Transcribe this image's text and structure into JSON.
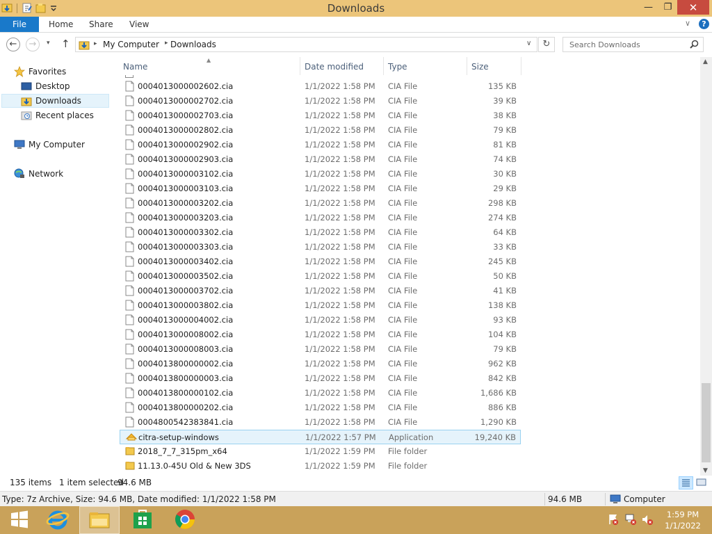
{
  "window": {
    "title": "Downloads",
    "minimize": "—",
    "maximize": "❐",
    "close": "✕"
  },
  "ribbon": {
    "file": "File",
    "home": "Home",
    "share": "Share",
    "view": "View",
    "expand": "∨",
    "help": "?"
  },
  "address": {
    "back": "←",
    "forward": "→",
    "recent": "▾",
    "up": "↑",
    "crumbs": [
      "My Computer",
      "Downloads"
    ],
    "sep": "▸",
    "dropdown": "∨",
    "refresh": "↻"
  },
  "search": {
    "placeholder": "Search Downloads"
  },
  "navpane": {
    "favorites": "Favorites",
    "desktop": "Desktop",
    "downloads": "Downloads",
    "recent_places": "Recent places",
    "my_computer": "My Computer",
    "network": "Network"
  },
  "columns": {
    "name": "Name",
    "date": "Date modified",
    "type": "Type",
    "size": "Size"
  },
  "files": [
    {
      "name": "0004013000002602.cia",
      "date": "1/1/2022 1:58 PM",
      "type": "CIA File",
      "size": "135 KB",
      "kind": "file"
    },
    {
      "name": "0004013000002702.cia",
      "date": "1/1/2022 1:58 PM",
      "type": "CIA File",
      "size": "39 KB",
      "kind": "file"
    },
    {
      "name": "0004013000002703.cia",
      "date": "1/1/2022 1:58 PM",
      "type": "CIA File",
      "size": "38 KB",
      "kind": "file"
    },
    {
      "name": "0004013000002802.cia",
      "date": "1/1/2022 1:58 PM",
      "type": "CIA File",
      "size": "79 KB",
      "kind": "file"
    },
    {
      "name": "0004013000002902.cia",
      "date": "1/1/2022 1:58 PM",
      "type": "CIA File",
      "size": "81 KB",
      "kind": "file"
    },
    {
      "name": "0004013000002903.cia",
      "date": "1/1/2022 1:58 PM",
      "type": "CIA File",
      "size": "74 KB",
      "kind": "file"
    },
    {
      "name": "0004013000003102.cia",
      "date": "1/1/2022 1:58 PM",
      "type": "CIA File",
      "size": "30 KB",
      "kind": "file"
    },
    {
      "name": "0004013000003103.cia",
      "date": "1/1/2022 1:58 PM",
      "type": "CIA File",
      "size": "29 KB",
      "kind": "file"
    },
    {
      "name": "0004013000003202.cia",
      "date": "1/1/2022 1:58 PM",
      "type": "CIA File",
      "size": "298 KB",
      "kind": "file"
    },
    {
      "name": "0004013000003203.cia",
      "date": "1/1/2022 1:58 PM",
      "type": "CIA File",
      "size": "274 KB",
      "kind": "file"
    },
    {
      "name": "0004013000003302.cia",
      "date": "1/1/2022 1:58 PM",
      "type": "CIA File",
      "size": "64 KB",
      "kind": "file"
    },
    {
      "name": "0004013000003303.cia",
      "date": "1/1/2022 1:58 PM",
      "type": "CIA File",
      "size": "33 KB",
      "kind": "file"
    },
    {
      "name": "0004013000003402.cia",
      "date": "1/1/2022 1:58 PM",
      "type": "CIA File",
      "size": "245 KB",
      "kind": "file"
    },
    {
      "name": "0004013000003502.cia",
      "date": "1/1/2022 1:58 PM",
      "type": "CIA File",
      "size": "50 KB",
      "kind": "file"
    },
    {
      "name": "0004013000003702.cia",
      "date": "1/1/2022 1:58 PM",
      "type": "CIA File",
      "size": "41 KB",
      "kind": "file"
    },
    {
      "name": "0004013000003802.cia",
      "date": "1/1/2022 1:58 PM",
      "type": "CIA File",
      "size": "138 KB",
      "kind": "file"
    },
    {
      "name": "0004013000004002.cia",
      "date": "1/1/2022 1:58 PM",
      "type": "CIA File",
      "size": "93 KB",
      "kind": "file"
    },
    {
      "name": "0004013000008002.cia",
      "date": "1/1/2022 1:58 PM",
      "type": "CIA File",
      "size": "104 KB",
      "kind": "file"
    },
    {
      "name": "0004013000008003.cia",
      "date": "1/1/2022 1:58 PM",
      "type": "CIA File",
      "size": "79 KB",
      "kind": "file"
    },
    {
      "name": "0004013800000002.cia",
      "date": "1/1/2022 1:58 PM",
      "type": "CIA File",
      "size": "962 KB",
      "kind": "file"
    },
    {
      "name": "0004013800000003.cia",
      "date": "1/1/2022 1:58 PM",
      "type": "CIA File",
      "size": "842 KB",
      "kind": "file"
    },
    {
      "name": "0004013800000102.cia",
      "date": "1/1/2022 1:58 PM",
      "type": "CIA File",
      "size": "1,686 KB",
      "kind": "file"
    },
    {
      "name": "0004013800000202.cia",
      "date": "1/1/2022 1:58 PM",
      "type": "CIA File",
      "size": "886 KB",
      "kind": "file"
    },
    {
      "name": "0004800542383841.cia",
      "date": "1/1/2022 1:58 PM",
      "type": "CIA File",
      "size": "1,290 KB",
      "kind": "file"
    },
    {
      "name": "citra-setup-windows",
      "date": "1/1/2022 1:57 PM",
      "type": "Application",
      "size": "19,240 KB",
      "kind": "app",
      "selected": true
    },
    {
      "name": "2018_7_7_315pm_x64",
      "date": "1/1/2022 1:59 PM",
      "type": "File folder",
      "size": "",
      "kind": "folder"
    },
    {
      "name": "11.13.0-45U Old & New 3DS",
      "date": "1/1/2022 1:59 PM",
      "type": "File folder",
      "size": "",
      "kind": "folder"
    }
  ],
  "status": {
    "items": "135 items",
    "selected": "1 item selected",
    "selected_size": "94.6 MB"
  },
  "details": {
    "description": "Type: 7z Archive, Size: 94.6 MB, Date modified: 1/1/2022 1:58 PM",
    "size": "94.6 MB",
    "location": "Computer"
  },
  "clock": {
    "time": "1:59 PM",
    "date": "1/1/2022"
  },
  "colors": {
    "titlebar": "#ecc57a",
    "taskbar": "#c9a25a",
    "file_tab": "#1979ca",
    "selection": "#e5f3fb",
    "close": "#c74b3f"
  }
}
